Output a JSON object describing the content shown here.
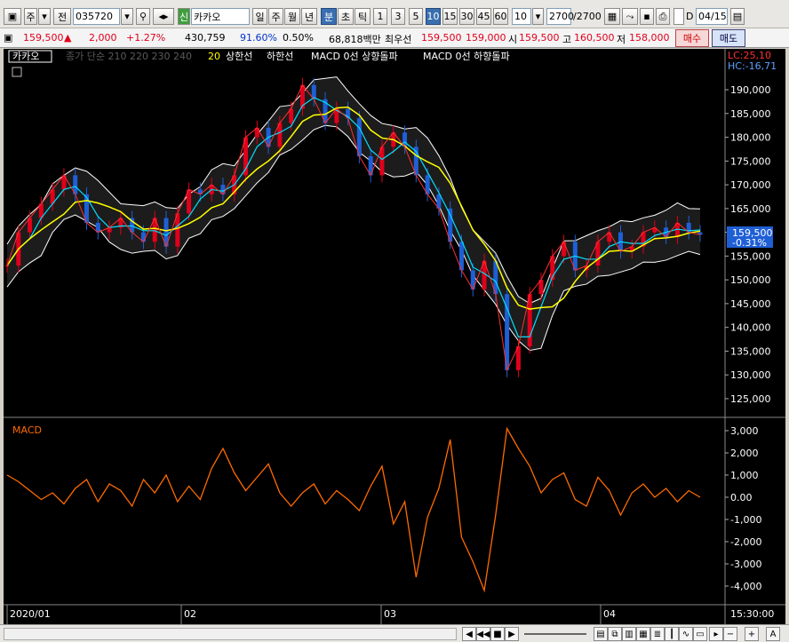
{
  "toolbar": {
    "type_label": "주",
    "jeon_label": "전",
    "code": "035720",
    "new_badge": "신",
    "name": "카카오",
    "periods": [
      "일",
      "주",
      "월",
      "년"
    ],
    "intervals": [
      "분",
      "초",
      "틱"
    ],
    "numbers": [
      "1",
      "3",
      "5",
      "10",
      "15",
      "30",
      "45",
      "60"
    ],
    "selected_number": "10",
    "count_value": "10",
    "bars_display": "2700",
    "bars_total": "/2700",
    "d_label": "D",
    "date_value": "04/15"
  },
  "quote": {
    "price": "159,500",
    "arrow": "▲",
    "change": "2,000",
    "change_pct": "+1.27%",
    "volume": "430,759",
    "ratio": "91.60%",
    "turnover": "0.50%",
    "amount": "68,818백만",
    "best_label": "최우선",
    "best_ask": "159,500",
    "best_bid": "159,000",
    "open_label": "시",
    "open": "159,500",
    "high_label": "고",
    "high": "160,500",
    "low_label": "저",
    "low": "158,000",
    "buy": "매수",
    "sell": "매도"
  },
  "legend": {
    "name_box": "카카오",
    "ma_label": "종가 단순 210 220 230 240",
    "ma_20": "20",
    "upper": "상한선",
    "lower": "하한선",
    "macd_up": "MACD 0선 상향돌파",
    "macd_down": "MACD 0선 하향돌파",
    "lc": "LC:25,10",
    "hc": "HC:-16,71",
    "current_price": "159,500",
    "current_pct": "-0.31%"
  },
  "price_axis": [
    "190,000",
    "185,000",
    "180,000",
    "175,000",
    "170,000",
    "165,000",
    "160,000",
    "155,000",
    "150,000",
    "145,000",
    "140,000",
    "135,000",
    "130,000",
    "125,000"
  ],
  "macd_axis": [
    "3,000",
    "2,000",
    "1,000",
    "0.00",
    "-1,000",
    "-2,000",
    "-3,000",
    "-4,000"
  ],
  "macd_title": "MACD",
  "x_axis": [
    "2020/01",
    "02",
    "03",
    "04"
  ],
  "time_label": "15:30:00",
  "colors": {
    "background": "#000000",
    "macd": "#ff6a00",
    "bollinger": "#ffffff",
    "ma20": "#ffff00",
    "up": "#e0001b",
    "down": "#1f5fd6"
  },
  "chart_data": [
    {
      "type": "line",
      "title": "",
      "series": [
        {
          "name": "종가",
          "values": [
            153000,
            160000,
            163000,
            166000,
            169000,
            172000,
            168000,
            162000,
            160000,
            161000,
            163000,
            160000,
            158000,
            163000,
            157000,
            164000,
            169000,
            168000,
            170000,
            168000,
            172000,
            180000,
            182000,
            178000,
            183000,
            186000,
            191000,
            188000,
            183000,
            186000,
            184000,
            176000,
            172000,
            178000,
            181000,
            178000,
            172000,
            168000,
            165000,
            158000,
            152000,
            148000,
            154000,
            147000,
            131000,
            136000,
            147000,
            150000,
            155000,
            158000,
            152000,
            153000,
            158000,
            160000,
            156000,
            157000,
            160000,
            161000,
            159000,
            162000,
            160000,
            159500
          ]
        }
      ],
      "ylim": [
        122000,
        193000
      ],
      "x_ticks": [
        "2020/01",
        "02",
        "03",
        "04"
      ]
    },
    {
      "type": "line",
      "title": "MACD",
      "series": [
        {
          "name": "MACD",
          "values": [
            1000,
            700,
            300,
            -100,
            200,
            -300,
            400,
            800,
            -200,
            600,
            300,
            -400,
            800,
            200,
            1000,
            -200,
            500,
            -100,
            1300,
            2200,
            1100,
            300,
            900,
            1500,
            200,
            -400,
            200,
            600,
            -300,
            300,
            -100,
            -600,
            500,
            1400,
            -1200,
            -200,
            -3600,
            -900,
            400,
            2600,
            -1800,
            -2900,
            -4200,
            -800,
            3100,
            2200,
            1400,
            200,
            800,
            1100,
            -100,
            -400,
            900,
            300,
            -800,
            200,
            600,
            0,
            400,
            -200,
            300,
            0
          ]
        }
      ],
      "ylim": [
        -4400,
        3400
      ]
    }
  ]
}
